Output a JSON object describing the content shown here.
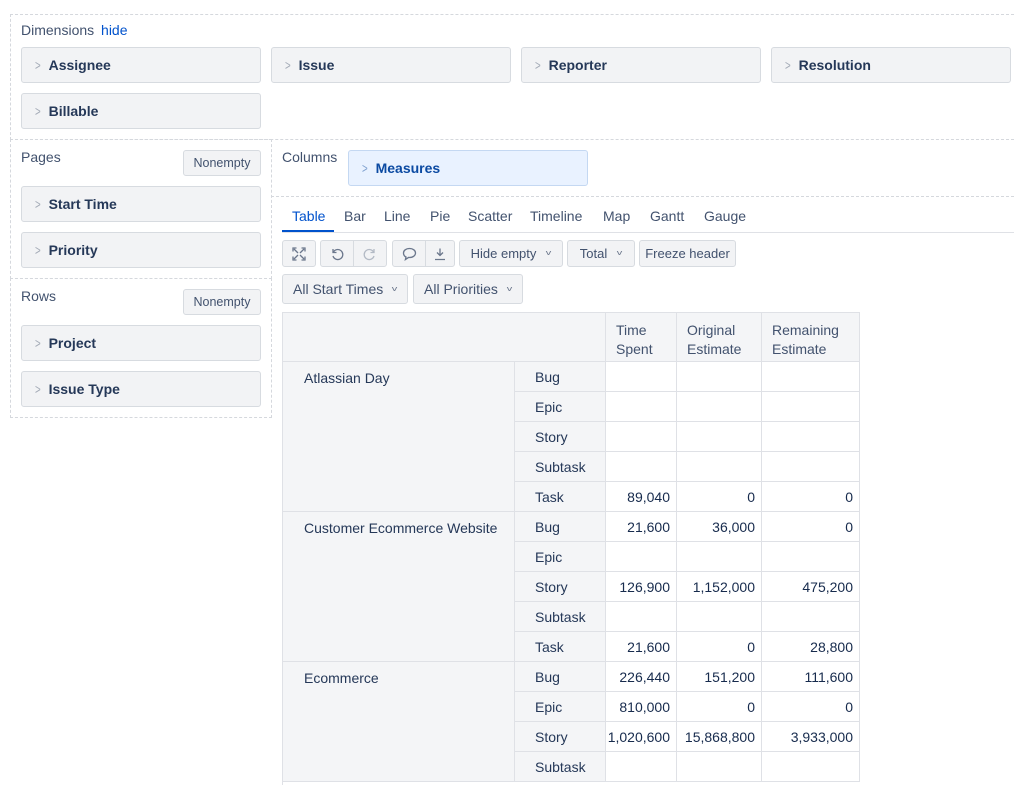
{
  "dimensions": {
    "label": "Dimensions",
    "hide_link": "hide",
    "items": [
      "Assignee",
      "Issue",
      "Reporter",
      "Resolution",
      "Billable"
    ]
  },
  "pages": {
    "label": "Pages",
    "nonempty": "Nonempty",
    "items": [
      "Start Time",
      "Priority"
    ]
  },
  "rows": {
    "label": "Rows",
    "nonempty": "Nonempty",
    "items": [
      "Project",
      "Issue Type"
    ]
  },
  "columns": {
    "label": "Columns",
    "items": [
      "Measures"
    ]
  },
  "chart_tabs": [
    "Table",
    "Bar",
    "Line",
    "Pie",
    "Scatter",
    "Timeline",
    "Map",
    "Gantt",
    "Gauge"
  ],
  "active_tab": "Table",
  "toolbar": {
    "hide_empty": "Hide empty",
    "total": "Total",
    "freeze_header": "Freeze header",
    "icons": [
      "fullscreen-icon",
      "undo-icon",
      "redo-icon",
      "comment-icon",
      "export-icon"
    ]
  },
  "filters": {
    "start_times": "All Start Times",
    "priorities": "All Priorities"
  },
  "table": {
    "columns": [
      [
        "Time",
        "Spent"
      ],
      [
        "Original",
        "Estimate"
      ],
      [
        "Remaining",
        "Estimate"
      ]
    ],
    "groups": [
      {
        "project": "Atlassian Day",
        "rows": [
          {
            "type": "Bug",
            "values": [
              "",
              "",
              ""
            ]
          },
          {
            "type": "Epic",
            "values": [
              "",
              "",
              ""
            ]
          },
          {
            "type": "Story",
            "values": [
              "",
              "",
              ""
            ]
          },
          {
            "type": "Subtask",
            "values": [
              "",
              "",
              ""
            ]
          },
          {
            "type": "Task",
            "values": [
              "89,040",
              "0",
              "0"
            ]
          }
        ]
      },
      {
        "project": "Customer Ecommerce Website",
        "rows": [
          {
            "type": "Bug",
            "values": [
              "21,600",
              "36,000",
              "0"
            ]
          },
          {
            "type": "Epic",
            "values": [
              "",
              "",
              ""
            ]
          },
          {
            "type": "Story",
            "values": [
              "126,900",
              "1,152,000",
              "475,200"
            ]
          },
          {
            "type": "Subtask",
            "values": [
              "",
              "",
              ""
            ]
          },
          {
            "type": "Task",
            "values": [
              "21,600",
              "0",
              "28,800"
            ]
          }
        ]
      },
      {
        "project": "Ecommerce",
        "rows": [
          {
            "type": "Bug",
            "values": [
              "226,440",
              "151,200",
              "111,600"
            ]
          },
          {
            "type": "Epic",
            "values": [
              "810,000",
              "0",
              "0"
            ]
          },
          {
            "type": "Story",
            "values": [
              "1,020,600",
              "15,868,800",
              "3,933,000"
            ]
          },
          {
            "type": "Subtask",
            "values": [
              "",
              "",
              ""
            ]
          }
        ]
      }
    ]
  }
}
